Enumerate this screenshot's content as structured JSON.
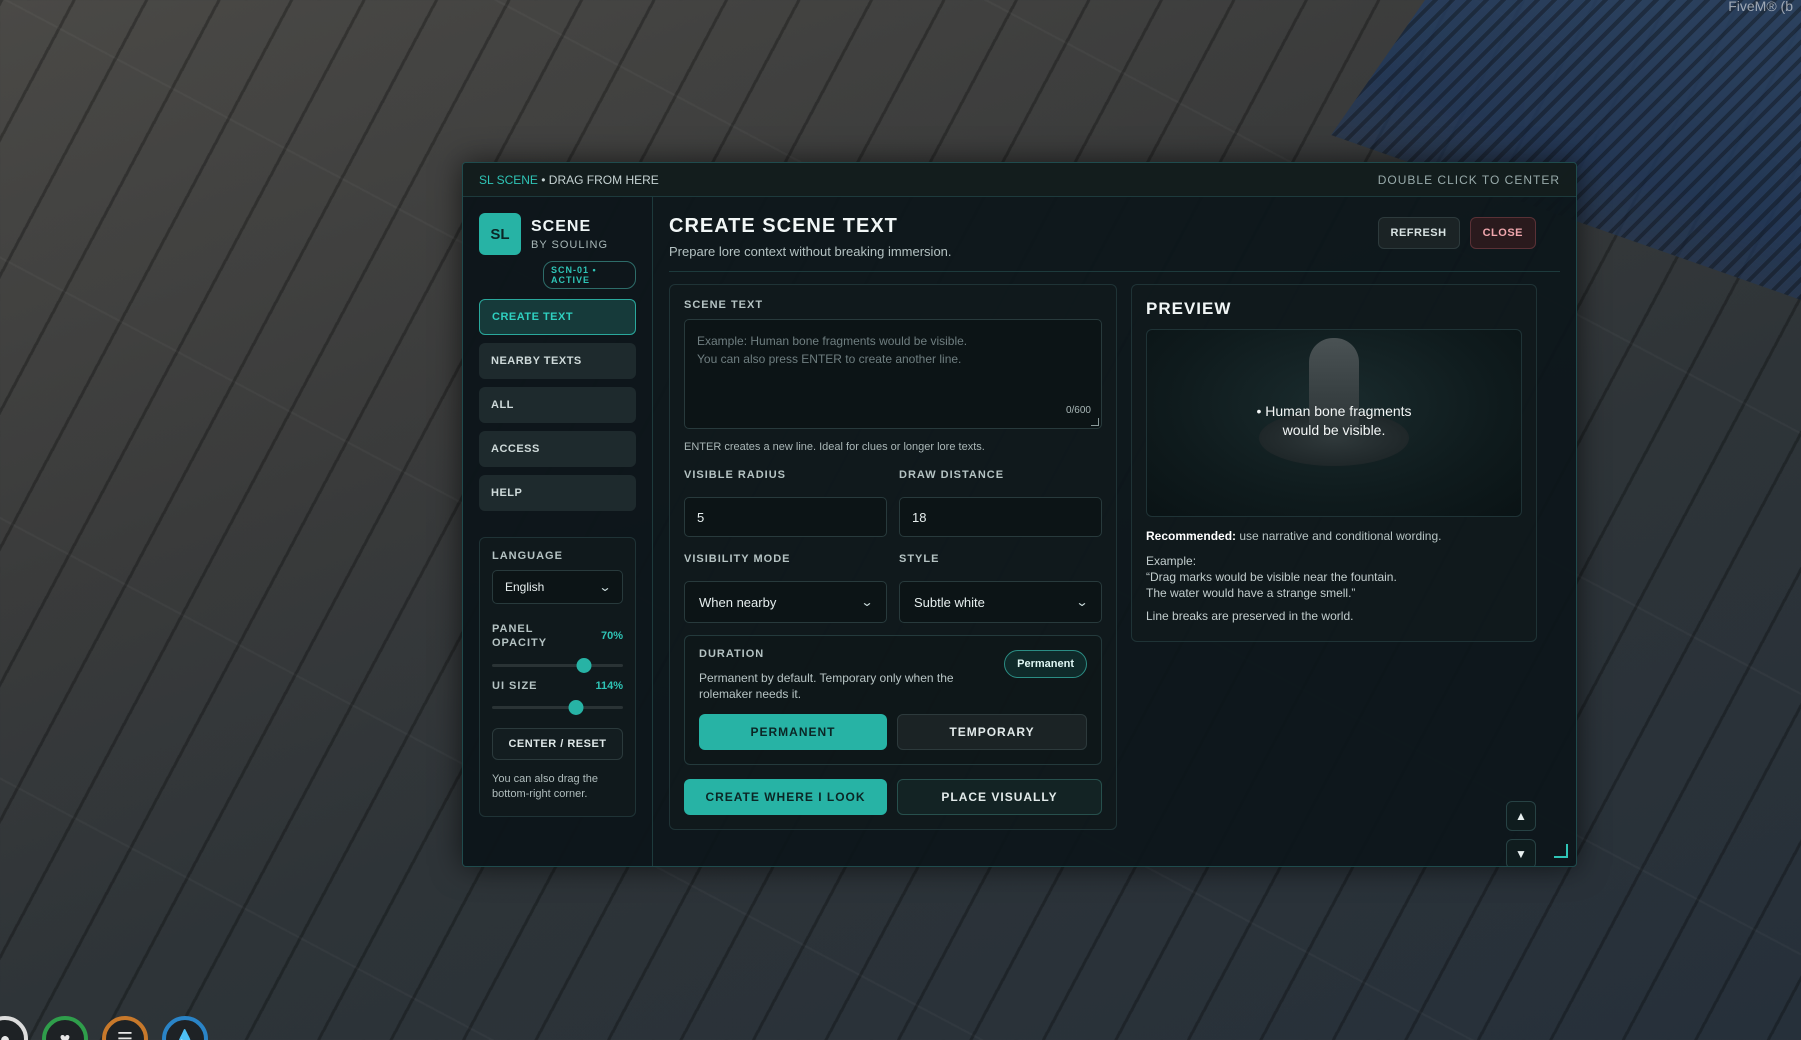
{
  "overlay": {
    "fivem_tag": "FiveM® (b"
  },
  "titlebar": {
    "brand": "SL SCENE",
    "drag_hint": " • DRAG FROM HERE",
    "center_hint": "DOUBLE CLICK TO CENTER"
  },
  "sidebar": {
    "logo": "SL",
    "title": "SCENE",
    "subtitle": "BY SOULING",
    "status": "SCN-01 • ACTIVE",
    "nav": [
      {
        "label": "CREATE TEXT",
        "active": true
      },
      {
        "label": "NEARBY TEXTS"
      },
      {
        "label": "ALL"
      },
      {
        "label": "ACCESS"
      },
      {
        "label": "HELP"
      }
    ],
    "settings": {
      "language_label": "LANGUAGE",
      "language_value": "English",
      "opacity_label": "PANEL OPACITY",
      "opacity_value": "70%",
      "opacity_fraction": 0.7,
      "ui_size_label": "UI SIZE",
      "ui_size_value": "114%",
      "ui_size_fraction": 0.64,
      "center_reset": "CENTER / RESET",
      "hint": "You can also drag the bottom-right corner."
    }
  },
  "main": {
    "title": "CREATE SCENE TEXT",
    "subtitle": "Prepare lore context without breaking immersion.",
    "refresh": "REFRESH",
    "close": "CLOSE",
    "form": {
      "scene_text_label": "SCENE TEXT",
      "placeholder_line1": "Example: Human bone fragments would be visible.",
      "placeholder_line2": "You can also press ENTER to create another line.",
      "counter": "0/600",
      "help": "ENTER creates a new line. Ideal for clues or longer lore texts.",
      "radius_label": "VISIBLE RADIUS",
      "radius_value": "5",
      "distance_label": "DRAW DISTANCE",
      "distance_value": "18",
      "mode_label": "VISIBILITY MODE",
      "mode_value": "When nearby",
      "style_label": "STYLE",
      "style_value": "Subtle white",
      "duration_label": "DURATION",
      "duration_text": "Permanent by default. Temporary only when the rolemaker needs it.",
      "duration_pill": "Permanent",
      "permanent_btn": "PERMANENT",
      "temporary_btn": "TEMPORARY",
      "create_btn": "CREATE WHERE I LOOK",
      "place_btn": "PLACE VISUALLY"
    },
    "preview": {
      "title": "PREVIEW",
      "text_line1": "• Human bone fragments",
      "text_line2": "would be visible.",
      "rec_label": "Recommended:",
      "rec_text": " use narrative and conditional wording.",
      "example_label": "Example:",
      "example_line1": "“Drag marks would be visible near the fountain.",
      "example_line2": "The water would have a strange smell.”",
      "preserved": "Line breaks are preserved in the world."
    }
  },
  "icons": {
    "chevron": "chevron-down-icon",
    "up": "arrow-up-icon",
    "down": "arrow-down-icon",
    "hud": [
      "person-icon",
      "heart-icon",
      "armor-icon",
      "water-drop-icon"
    ]
  }
}
